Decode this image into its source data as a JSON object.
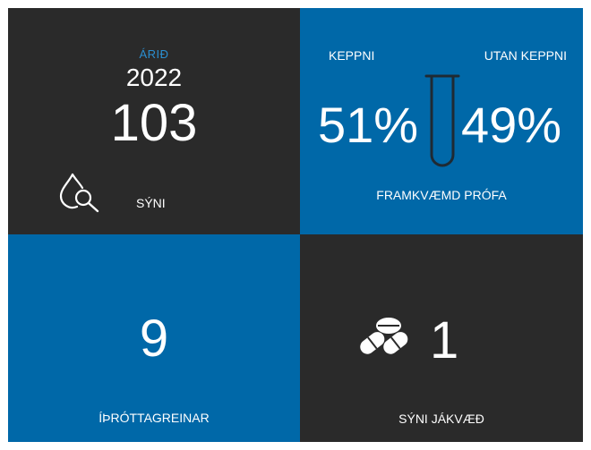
{
  "samples": {
    "year_label": "ÁRIÐ",
    "year_value": "2022",
    "count": "103",
    "label": "SÝNI",
    "icon": "drop-magnifier-icon"
  },
  "tests": {
    "competition_label": "KEPPNI",
    "out_of_competition_label": "UTAN KEPPNI",
    "competition_percent": "51%",
    "out_of_competition_percent": "49%",
    "label": "FRAMKVÆMD PRÓFA",
    "icon": "test-tube-icon",
    "competition_share": 0.51,
    "out_of_competition_share": 0.49
  },
  "sports": {
    "count": "9",
    "label": "ÍÞRÓTTAGREINAR"
  },
  "positive": {
    "count": "1",
    "label": "SÝNI JÁKVÆÐ",
    "icon": "pills-icon"
  },
  "colors": {
    "dark_tile": "#2a2a2a",
    "blue_tile": "#0068a8",
    "year_label_accent": "#2b8fd0",
    "text": "#ffffff"
  }
}
